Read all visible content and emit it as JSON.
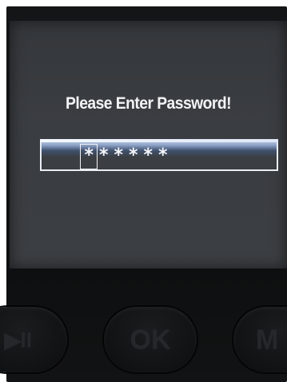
{
  "screen": {
    "prompt": "Please Enter Password!",
    "password_digits": [
      "*",
      "*",
      "*",
      "*",
      "*",
      "*"
    ],
    "cursor_position": 1
  },
  "hardware_buttons": {
    "left_label": "▶II",
    "ok_label": "OK",
    "menu_label": "M"
  },
  "colors": {
    "screen_bg": "#3b3e42",
    "text": "#f2f3f5",
    "field_highlight": "#8ea3c8"
  }
}
